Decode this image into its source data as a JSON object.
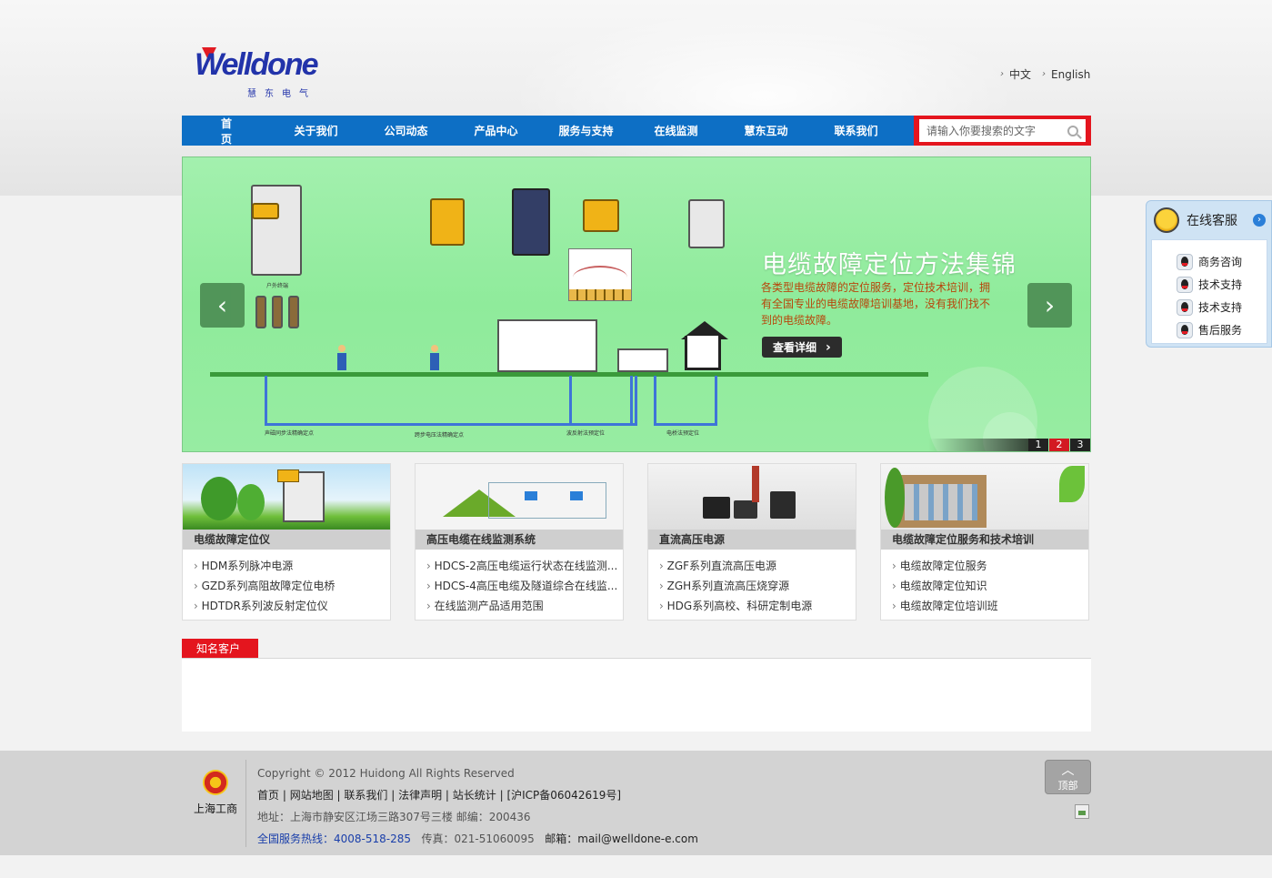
{
  "header": {
    "logo": {
      "word": "Welldone",
      "sub": "慧东电气"
    },
    "languages": [
      "中文",
      "English"
    ]
  },
  "nav": {
    "items": [
      "首　页",
      "关于我们",
      "公司动态",
      "产品中心",
      "服务与支持",
      "在线监测",
      "慧东互动",
      "联系我们"
    ],
    "search_placeholder": "请输入你要搜索的文字"
  },
  "banner": {
    "title": "电缆故障定位方法集锦",
    "description": "各类型电缆故障的定位服务，定位技术培训，拥有全国专业的电缆故障培训基地，没有我们找不到的电缆故障。",
    "cta": "查看详细",
    "slides": [
      "1",
      "2",
      "3"
    ],
    "active_slide": 2,
    "diagram_labels": [
      "户外终端",
      "声磁同步法精确定点",
      "跨步电压法精确定点",
      "波反射法预定位",
      "电桥法预定位"
    ]
  },
  "categories": [
    {
      "caption": "电缆故障定位仪",
      "items": [
        "HDM系列脉冲电源",
        "GZD系列高阻故障定位电桥",
        "HDTDR系列波反射定位仪"
      ]
    },
    {
      "caption": "高压电缆在线监测系统",
      "items": [
        "HDCS-2高压电缆运行状态在线监测...",
        "HDCS-4高压电缆及隧道综合在线监...",
        "在线监测产品适用范围"
      ]
    },
    {
      "caption": "直流高压电源",
      "items": [
        "ZGF系列直流高压电源",
        "ZGH系列直流高压烧穿源",
        "HDG系列高校、科研定制电源"
      ]
    },
    {
      "caption": "电缆故障定位服务和技术培训",
      "items": [
        "电缆故障定位服务",
        "电缆故障定位知识",
        "电缆故障定位培训班"
      ]
    }
  ],
  "clients": {
    "tab": "知名客户"
  },
  "footer": {
    "badge": "上海工商",
    "copyright": "Copyright © 2012 Huidong All Rights Reserved",
    "links": [
      "首页",
      "网站地图",
      "联系我们",
      "法律声明",
      "站长统计",
      "[沪ICP备06042619号]"
    ],
    "address": "地址：上海市静安区江场三路307号三楼  邮编：200436",
    "hotline_label": "全国服务热线：4008-518-285",
    "fax": "传真：021-51060095",
    "email": "邮箱：mail@welldone-e.com",
    "top_button": "顶部"
  },
  "service_panel": {
    "title": "在线客服",
    "items": [
      "商务咨询",
      "技术支持",
      "技术支持",
      "售后服务"
    ]
  },
  "colors": {
    "nav_blue": "#0d6fc5",
    "accent_red": "#e4151e",
    "banner_green": "#97eca2",
    "desc_orange": "#b8460b"
  }
}
